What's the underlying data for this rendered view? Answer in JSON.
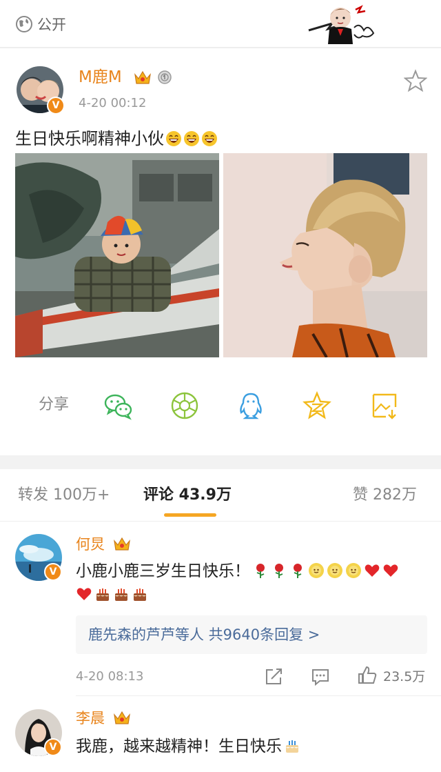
{
  "topbar": {
    "visibility_label": "公开",
    "globe_icon": "globe-icon",
    "sticker_icon": "profile-sticker"
  },
  "post": {
    "username": "M鹿M",
    "time": "4-20 00:12",
    "text": "生日快乐啊精神小伙",
    "emojis": [
      "laughing-emoji",
      "laughing-emoji",
      "laughing-emoji"
    ],
    "photos": [
      "childhood-airplane-photo",
      "blond-profile-photo"
    ]
  },
  "share": {
    "label": "分享",
    "icons": [
      "wechat-icon",
      "moments-icon",
      "qq-icon",
      "qzone-icon",
      "save-image-icon"
    ]
  },
  "tabs": {
    "repost": "转发 100万+",
    "comments": "评论 43.9万",
    "likes": "赞 282万"
  },
  "comments": [
    {
      "name": "何炅",
      "text": "小鹿小鹿三岁生日快乐！",
      "reply_summary": "鹿先森的芦芦等人  共9640条回复 >",
      "time": "4-20 08:13",
      "like_count": "23.5万"
    },
    {
      "name": "李晨",
      "text": "我鹿，越来越精神！生日快乐"
    }
  ],
  "colors": {
    "accent_orange": "#e8841c",
    "tab_underline": "#f5a623",
    "link_blue": "#4a6b9a",
    "wechat_green": "#3cb45a",
    "moments_green": "#8cc43c",
    "qq_blue": "#3a9ee0",
    "qzone_yellow": "#f2b91a"
  }
}
